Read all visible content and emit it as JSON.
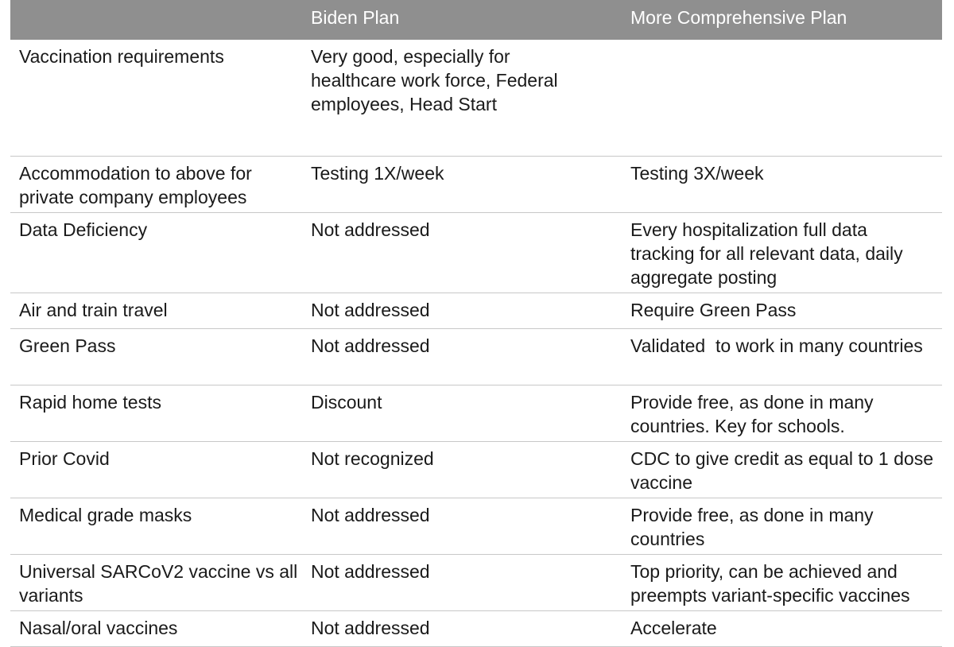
{
  "table": {
    "headers": [
      "",
      "Biden Plan",
      "More Comprehensive Plan"
    ],
    "rows": [
      [
        "Vaccination requirements",
        "Very good, especially for healthcare work force, Federal employees, Head Start",
        ""
      ],
      [
        "Accommodation to above for private company employees",
        "Testing 1X/week",
        "Testing 3X/week"
      ],
      [
        "Data Deficiency",
        "Not addressed",
        "Every hospitalization full data tracking for all relevant data, daily aggregate posting"
      ],
      [
        "Air and train travel",
        "Not addressed",
        "Require Green Pass"
      ],
      [
        "Green Pass",
        "Not addressed",
        "Validated  to work in many countries"
      ],
      [
        "Rapid home tests",
        "Discount",
        "Provide free, as done in many countries. Key for schools."
      ],
      [
        "Prior Covid",
        "Not recognized",
        "CDC to give credit as equal to 1 dose vaccine"
      ],
      [
        "Medical grade masks",
        "Not addressed",
        "Provide free, as done in many countries"
      ],
      [
        "Universal SARCoV2 vaccine vs all variants",
        "Not addressed",
        "Top priority, can be achieved and preempts variant-specific vaccines"
      ],
      [
        "Nasal/oral vaccines",
        "Not addressed",
        "Accelerate"
      ]
    ]
  },
  "colors": {
    "header_bg": "#8f8f8f",
    "header_text": "#ffffff",
    "row_border": "#c8c8c8",
    "body_text": "#1a1a1a"
  }
}
